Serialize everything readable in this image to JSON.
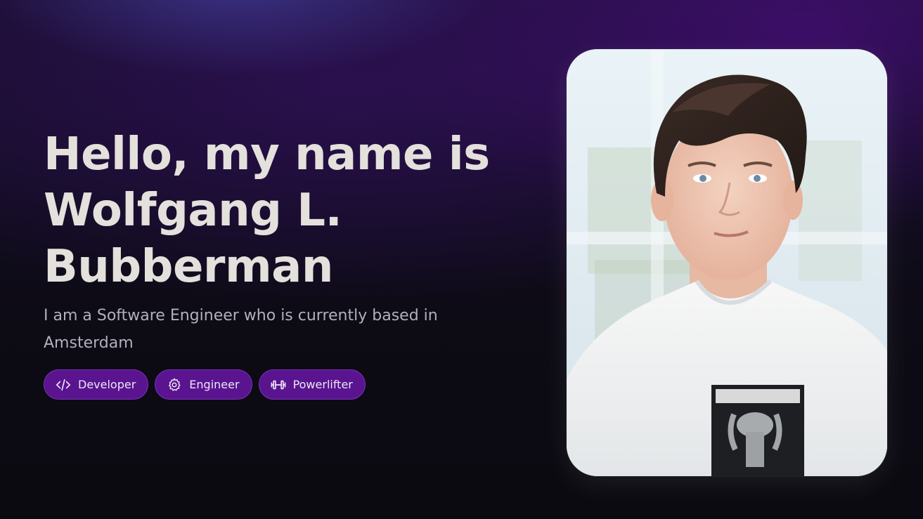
{
  "hero": {
    "headline_lines": [
      "Hello, my name is",
      "Wolfgang L.",
      "Bubberman"
    ],
    "subtitle": "I am a Software Engineer who is currently based in Amsterdam",
    "tags": [
      {
        "label": "Developer",
        "icon": "code-icon"
      },
      {
        "label": "Engineer",
        "icon": "gear-icon"
      },
      {
        "label": "Powerlifter",
        "icon": "dumbbell-icon"
      }
    ]
  },
  "portrait": {
    "subject": "profile-photo"
  },
  "colors": {
    "tag_background": "#5a1490",
    "tag_border": "#7b2fb8",
    "headline": "#e4e0dc",
    "subtitle": "#b3afbd"
  }
}
